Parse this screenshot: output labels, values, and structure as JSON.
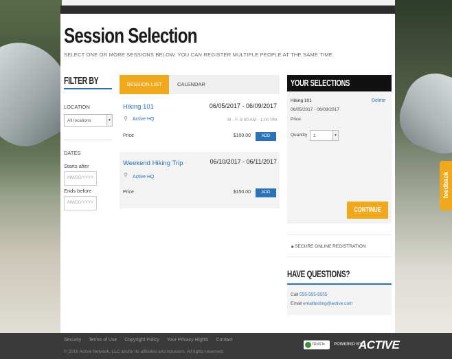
{
  "page": {
    "title": "Session Selection",
    "subtitle": "SELECT ONE OR MORE SESSIONS BELOW. YOU CAN REGISTER MULTIPLE PEOPLE AT THE SAME TIME."
  },
  "filter": {
    "heading": "FILTER BY",
    "location_label": "LOCATION",
    "location_value": "All locations",
    "dates_label": "DATES",
    "starts_after_label": "Starts after",
    "starts_after_placeholder": "MM/DD/YYYY",
    "ends_before_label": "Ends before",
    "ends_before_placeholder": "MM/DD/YYYY"
  },
  "tabs": {
    "session_list": "SESSION LIST",
    "calendar": "CALENDAR"
  },
  "sessions": [
    {
      "title": "Hiking 101",
      "dates": "06/05/2017 - 06/09/2017",
      "location": "Active HQ",
      "schedule": "M - F, 9:00 AM - 1:00 PM",
      "price_label": "Price",
      "price": "$100.00",
      "add_label": "ADD"
    },
    {
      "title": "Weekend Hiking Trip",
      "dates": "06/10/2017 - 06/11/2017",
      "location": "Active HQ",
      "schedule": "",
      "price_label": "Price",
      "price": "$150.00",
      "add_label": "ADD"
    }
  ],
  "selections": {
    "heading": "YOUR SELECTIONS",
    "item_title": "Hiking 101",
    "item_dates": "06/05/2017 - 06/09/2017",
    "price_label": "Price",
    "delete_label": "Delete",
    "quantity_label": "Quantity",
    "quantity_value": "1",
    "continue_label": "CONTINUE"
  },
  "secure": {
    "text": "SECURE ONLINE REGISTRATION",
    "icon": "lock-icon"
  },
  "questions": {
    "heading": "HAVE QUESTIONS?",
    "call_label": "Call",
    "phone": "555-555-5555",
    "email_label": "Email",
    "email": "emailtesting@active.com"
  },
  "footer": {
    "links": [
      "Security",
      "Terms of Use",
      "Copyright Policy",
      "Your Privacy Rights",
      "Contact"
    ],
    "copyright": "© 2016 Active Network, LLC and/or its affiliates and licensors. All rights reserved.",
    "trust_badge": "TRUSTe",
    "powered_by": "POWERED BY",
    "brand": "ACTIVE"
  },
  "feedback_tab": "feedback",
  "colors": {
    "accent": "#f0a91c",
    "link": "#2c72b6",
    "header_dark": "#111111"
  }
}
